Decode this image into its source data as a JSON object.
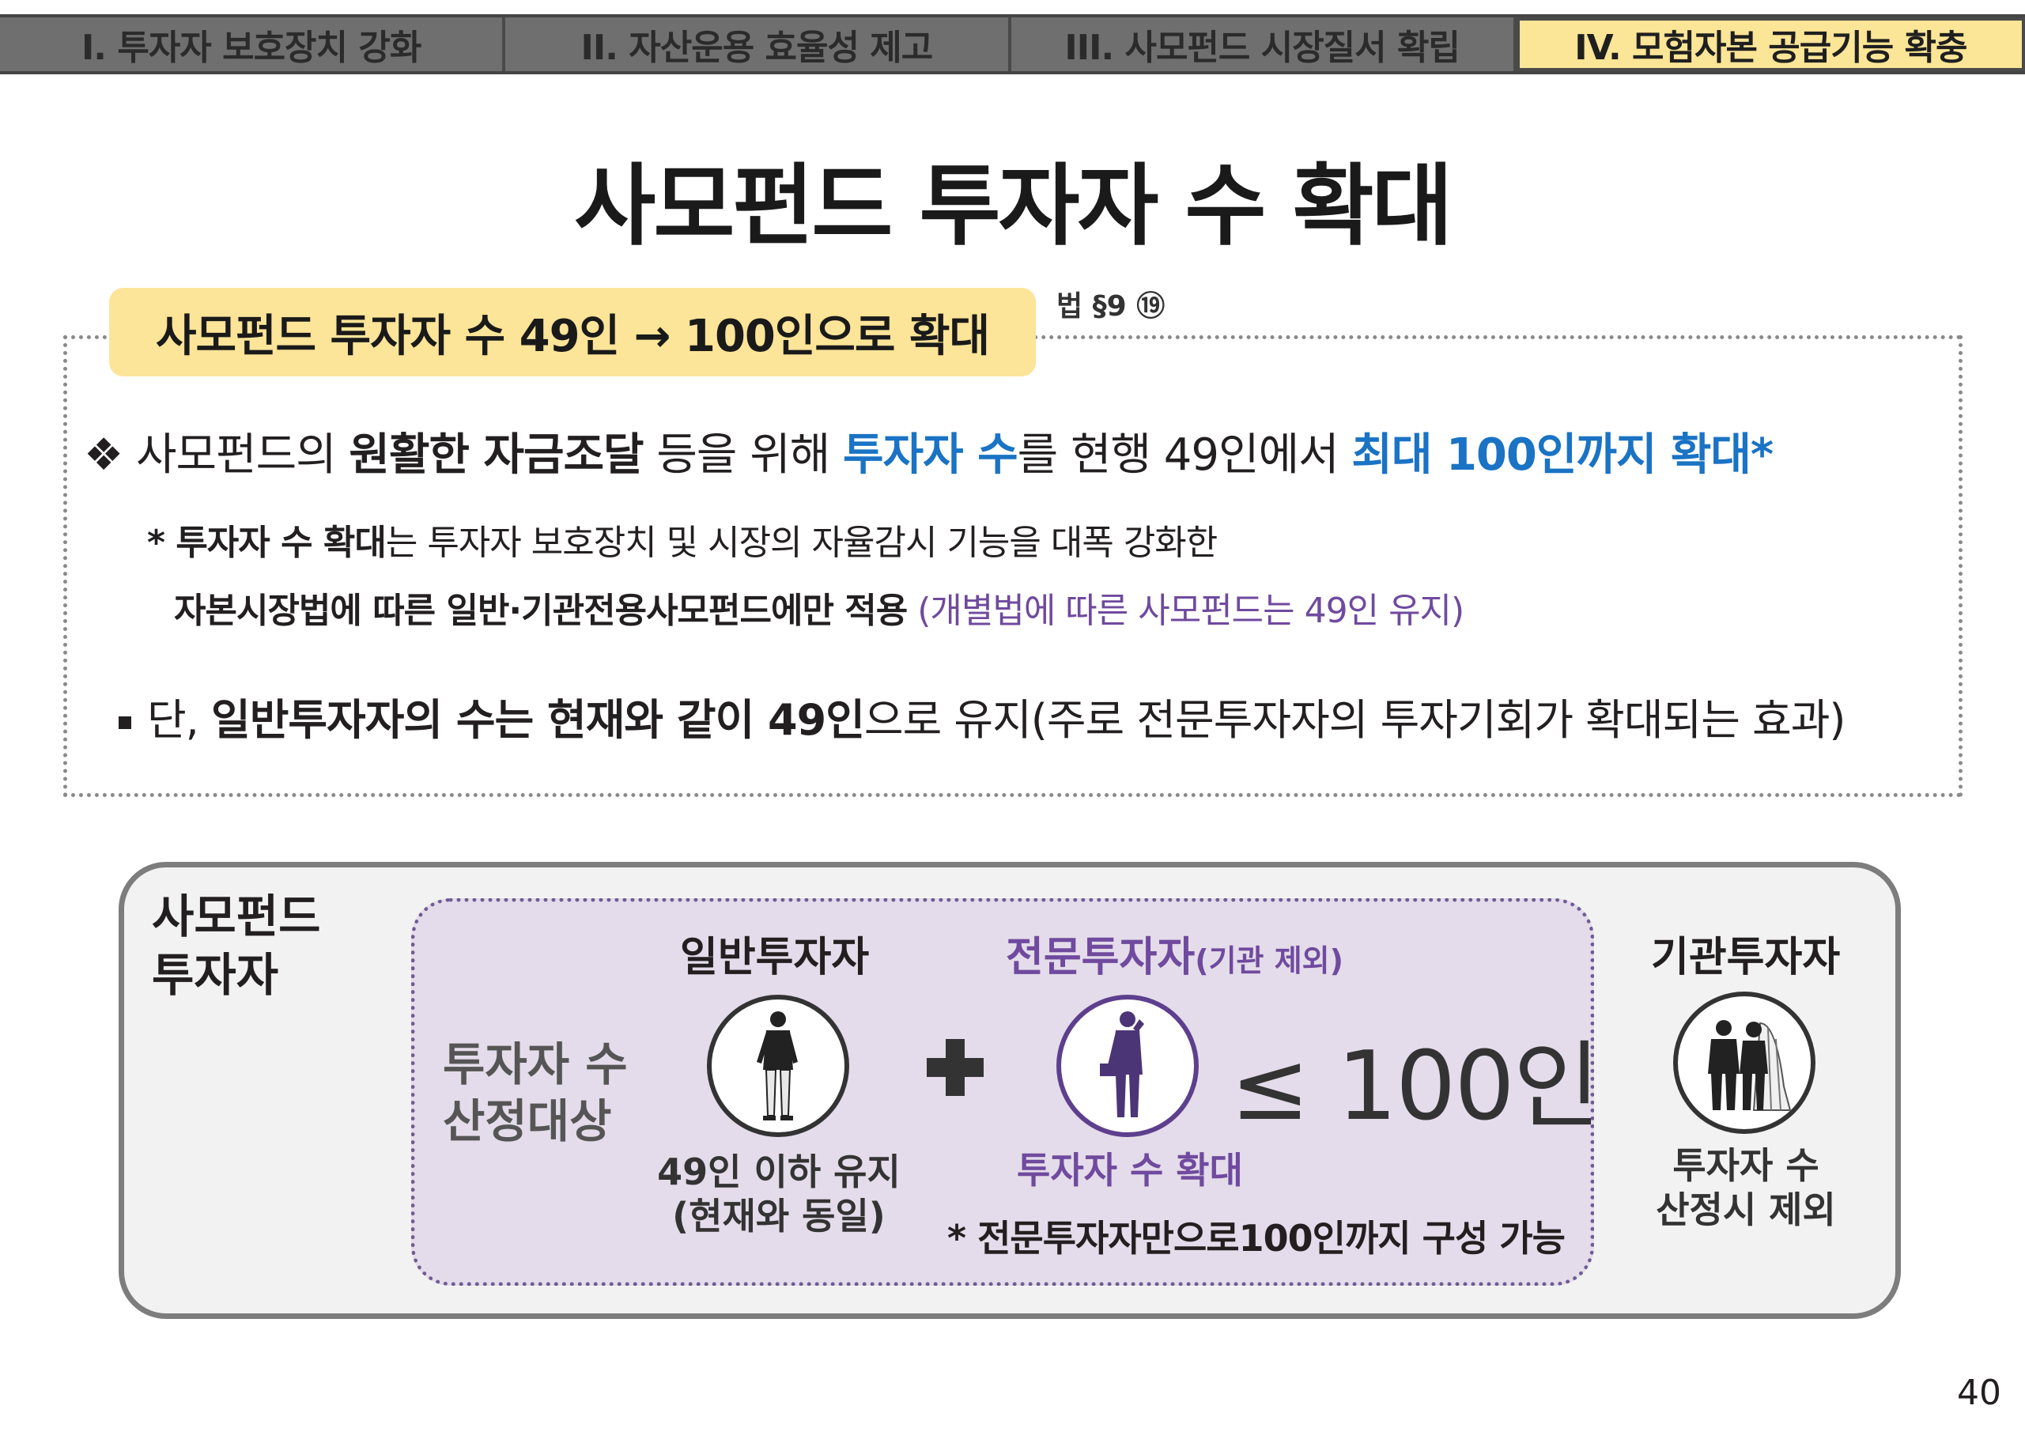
{
  "tabs": [
    {
      "label": "I. 투자자 보호장치 강화"
    },
    {
      "label": "II. 자산운용 효율성 제고"
    },
    {
      "label": "III. 사모펀드 시장질서 확립"
    },
    {
      "label": "IV. 모험자본 공급기능 확충"
    }
  ],
  "title": "사모펀드 투자자 수 확대",
  "summary": {
    "headline": "사모펀드 투자자 수 49인 → 100인으로 확대",
    "law_ref": "법 §9 ⑲",
    "line1": {
      "bullet": "❖",
      "p1": "사모펀드의 ",
      "p2": "원활한 자금조달",
      "p3": " 등을 위해 ",
      "p4": "투자자 수",
      "p5": "를 현행 49인에서 ",
      "p6": "최대 100인까지 확대*"
    },
    "note1": {
      "p1": "* 투자자 수 확대",
      "p2": "는 투자자 보호장치 및 시장의 자율감시 기능을 대폭 강화한"
    },
    "note2": {
      "p1": "자본시장법에 따른 일반·기관전용사모펀드에만 적용",
      "p2": " (개별법에 따른 사모펀드는 49인 유지)"
    },
    "line3": {
      "p1": "단, ",
      "p2": "일반투자자의 수는 현재와 같이 49인",
      "p3": "으로 유지(주로 전문투자자의 투자기회가 확대되는 효과)"
    }
  },
  "diagram": {
    "label_line1": "사모펀드",
    "label_line2": "투자자",
    "calc_line1": "투자자 수",
    "calc_line2": "산정대상",
    "general": {
      "heading": "일반투자자",
      "sub_line1": "49인 이하 유지",
      "sub_line2": "(현재와 동일)",
      "icon": "person-casual-icon"
    },
    "professional": {
      "heading": "전문투자자",
      "heading_suffix": "(기관 제외)",
      "sub": "투자자 수 확대",
      "note": "* 전문투자자만으로100인까지 구성 가능",
      "icon": "businessman-phone-icon"
    },
    "limit": "≤ 100인",
    "institutional": {
      "heading": "기관투자자",
      "sub_line1": "투자자 수",
      "sub_line2": "산정시 제외",
      "icon": "business-people-icon"
    }
  },
  "page_number": "40",
  "colors": {
    "active_tab": "#fbe596",
    "accent_blue": "#1a73c4",
    "accent_purple": "#6f4a9e",
    "inner_box": "#e4dcea"
  }
}
